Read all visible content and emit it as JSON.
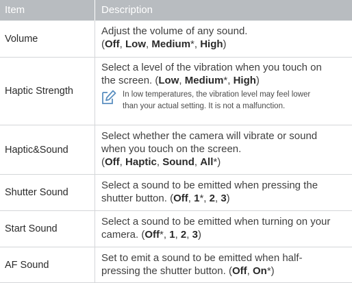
{
  "header": {
    "item": "Item",
    "description": "Description"
  },
  "rows": [
    {
      "item": "Volume",
      "line1": "Adjust the volume of any sound.",
      "options": [
        {
          "t": "(",
          "b": false
        },
        {
          "t": "Off",
          "b": true
        },
        {
          "t": ", ",
          "b": false
        },
        {
          "t": "Low",
          "b": true
        },
        {
          "t": ", ",
          "b": false
        },
        {
          "t": "Medium",
          "b": true
        },
        {
          "t": "*, ",
          "b": false
        },
        {
          "t": "High",
          "b": true
        },
        {
          "t": ")",
          "b": false
        }
      ]
    },
    {
      "item": "Haptic Strength",
      "line1": "Select a level of the vibration when you touch on",
      "line2pre": "the screen. ",
      "options": [
        {
          "t": "(",
          "b": false
        },
        {
          "t": "Low",
          "b": true
        },
        {
          "t": ", ",
          "b": false
        },
        {
          "t": "Medium",
          "b": true
        },
        {
          "t": "*, ",
          "b": false
        },
        {
          "t": "High",
          "b": true
        },
        {
          "t": ")",
          "b": false
        }
      ],
      "note1": "In low temperatures, the vibration level may feel lower",
      "note2": "than your actual setting. It is not a malfunction."
    },
    {
      "item": "Haptic&Sound",
      "line1": "Select whether the camera will vibrate or sound",
      "line2": "when you touch on the screen.",
      "options": [
        {
          "t": "(",
          "b": false
        },
        {
          "t": "Off",
          "b": true
        },
        {
          "t": ", ",
          "b": false
        },
        {
          "t": "Haptic",
          "b": true
        },
        {
          "t": ", ",
          "b": false
        },
        {
          "t": "Sound",
          "b": true
        },
        {
          "t": ", ",
          "b": false
        },
        {
          "t": "All",
          "b": true
        },
        {
          "t": "*)",
          "b": false
        }
      ]
    },
    {
      "item": "Shutter Sound",
      "line1": "Select a sound to be emitted when pressing the",
      "line2pre": "shutter button. ",
      "options": [
        {
          "t": "(",
          "b": false
        },
        {
          "t": "Off",
          "b": true
        },
        {
          "t": ", ",
          "b": false
        },
        {
          "t": "1",
          "b": true
        },
        {
          "t": "*, ",
          "b": false
        },
        {
          "t": "2",
          "b": true
        },
        {
          "t": ", ",
          "b": false
        },
        {
          "t": "3",
          "b": true
        },
        {
          "t": ")",
          "b": false
        }
      ]
    },
    {
      "item": "Start Sound",
      "line1": "Select a sound to be emitted when turning on your",
      "line2pre": "camera. ",
      "options": [
        {
          "t": "(",
          "b": false
        },
        {
          "t": "Off",
          "b": true
        },
        {
          "t": "*, ",
          "b": false
        },
        {
          "t": "1",
          "b": true
        },
        {
          "t": ", ",
          "b": false
        },
        {
          "t": "2",
          "b": true
        },
        {
          "t": ", ",
          "b": false
        },
        {
          "t": "3",
          "b": true
        },
        {
          "t": ")",
          "b": false
        }
      ]
    },
    {
      "item": "AF Sound",
      "line1": "Set to emit a sound to be emitted when half-",
      "line2pre": "pressing the shutter button. ",
      "options": [
        {
          "t": "(",
          "b": false
        },
        {
          "t": "Off",
          "b": true
        },
        {
          "t": ", ",
          "b": false
        },
        {
          "t": "On",
          "b": true
        },
        {
          "t": "*)",
          "b": false
        }
      ]
    }
  ],
  "note_icon": "pencil-note-icon",
  "colors": {
    "header_bg": "#b8bcc0",
    "header_text": "#ffffff",
    "divider": "#d4d6d8",
    "text": "#3f3f3f",
    "note_icon": "#5a8fc0"
  }
}
